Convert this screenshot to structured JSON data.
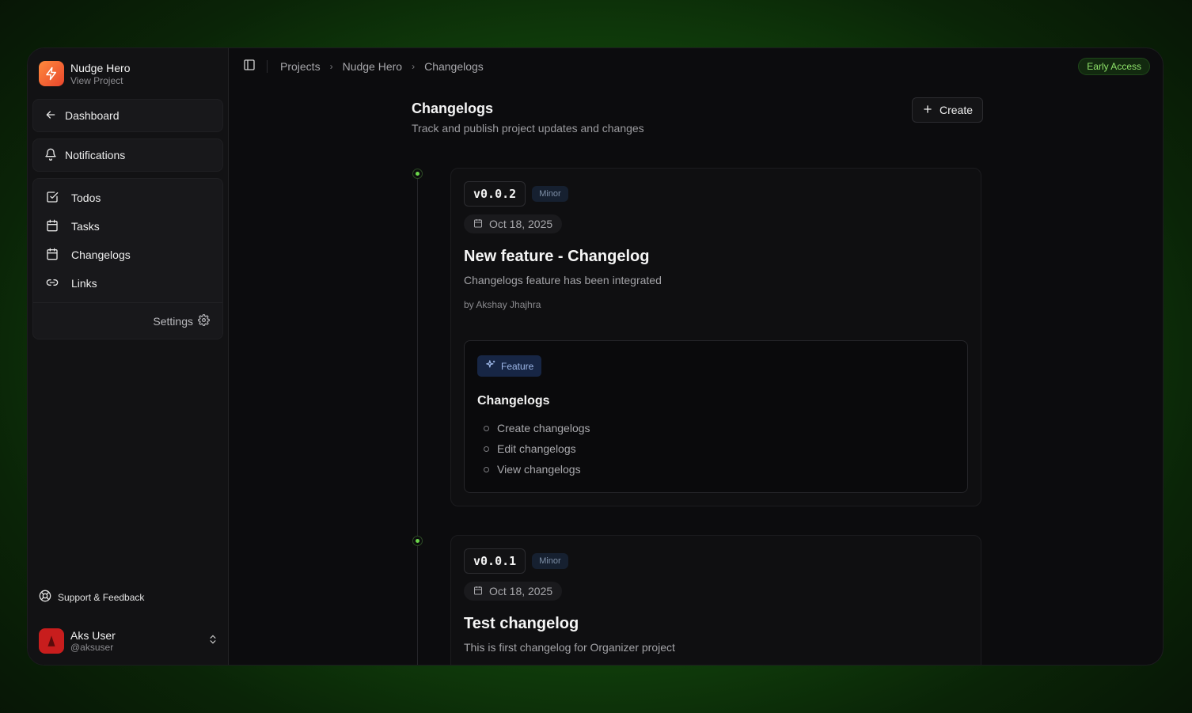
{
  "project": {
    "name": "Nudge Hero",
    "sub": "View Project"
  },
  "nav": {
    "dashboard": "Dashboard",
    "notifications": "Notifications",
    "items": [
      {
        "label": "Todos",
        "icon": "check-square-icon"
      },
      {
        "label": "Tasks",
        "icon": "calendar-icon"
      },
      {
        "label": "Changelogs",
        "icon": "calendar-icon"
      },
      {
        "label": "Links",
        "icon": "link-icon"
      }
    ],
    "settings": "Settings"
  },
  "support": "Support & Feedback",
  "user": {
    "name": "Aks User",
    "handle": "@aksuser"
  },
  "breadcrumb": [
    "Projects",
    "Nudge Hero",
    "Changelogs"
  ],
  "badge": "Early Access",
  "page": {
    "title": "Changelogs",
    "subtitle": "Track and publish project updates and changes",
    "create": "Create"
  },
  "entries": [
    {
      "version": "v0.0.2",
      "type": "Minor",
      "date": "Oct 18, 2025",
      "title": "New feature - Changelog",
      "description": "Changelogs feature has been integrated",
      "author": "by Akshay Jhajhra",
      "section": {
        "tag": "Feature",
        "title": "Changelogs",
        "items": [
          "Create changelogs",
          "Edit changelogs",
          "View changelogs"
        ]
      }
    },
    {
      "version": "v0.0.1",
      "type": "Minor",
      "date": "Oct 18, 2025",
      "title": "Test changelog",
      "description": "This is first changelog for Organizer project"
    }
  ],
  "colors": {
    "accent": "#6bd64a",
    "brand": "#e8452c",
    "background": "#0c0c0e"
  }
}
